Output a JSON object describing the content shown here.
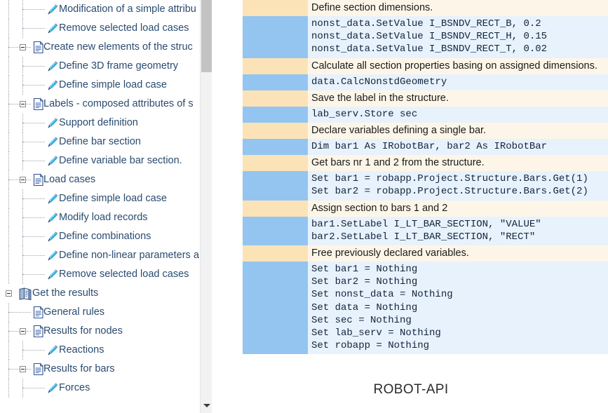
{
  "tree": {
    "items": [
      {
        "label": "Modification of a simple attribu",
        "level": 2,
        "icon": "pencil-icon",
        "expander": false,
        "truncated": true
      },
      {
        "label": "Remove selected load cases",
        "level": 2,
        "icon": "pencil-icon",
        "expander": false,
        "truncated": false,
        "last": true
      },
      {
        "label": "Create new elements of the struc",
        "level": 1,
        "icon": "page-icon",
        "expander": "minus",
        "truncated": true
      },
      {
        "label": "Define 3D frame geometry",
        "level": 2,
        "icon": "pencil-icon",
        "expander": false,
        "truncated": false
      },
      {
        "label": "Define simple load case",
        "level": 2,
        "icon": "pencil-icon",
        "expander": false,
        "truncated": false,
        "last": true
      },
      {
        "label": "Labels - composed attributes of s",
        "level": 1,
        "icon": "page-icon",
        "expander": "minus",
        "truncated": true
      },
      {
        "label": "Support definition",
        "level": 2,
        "icon": "pencil-icon",
        "expander": false,
        "truncated": false
      },
      {
        "label": "Define bar section",
        "level": 2,
        "icon": "pencil-icon",
        "expander": false,
        "truncated": false
      },
      {
        "label": "Define variable bar section.",
        "level": 2,
        "icon": "pencil-icon",
        "expander": false,
        "truncated": false,
        "last": true
      },
      {
        "label": "Load cases",
        "level": 1,
        "icon": "page-icon",
        "expander": "minus",
        "truncated": false
      },
      {
        "label": "Define simple load case",
        "level": 2,
        "icon": "pencil-icon",
        "expander": false,
        "truncated": false
      },
      {
        "label": "Modify load records",
        "level": 2,
        "icon": "pencil-icon",
        "expander": false,
        "truncated": false
      },
      {
        "label": "Define combinations",
        "level": 2,
        "icon": "pencil-icon",
        "expander": false,
        "truncated": false
      },
      {
        "label": "Define non-linear parameters a",
        "level": 2,
        "icon": "pencil-icon",
        "expander": false,
        "truncated": true
      },
      {
        "label": "Remove selected load cases",
        "level": 2,
        "icon": "pencil-icon",
        "expander": false,
        "truncated": false,
        "last": true
      },
      {
        "label": "Get the results",
        "level": 0,
        "icon": "book-icon",
        "expander": "minus",
        "truncated": false
      },
      {
        "label": "General rules",
        "level": 1,
        "icon": "page-icon",
        "expander": false,
        "truncated": false
      },
      {
        "label": "Results for nodes",
        "level": 1,
        "icon": "page-icon",
        "expander": "minus",
        "truncated": false
      },
      {
        "label": "Reactions",
        "level": 2,
        "icon": "pencil-icon",
        "expander": false,
        "truncated": false,
        "last": true
      },
      {
        "label": "Results for bars",
        "level": 1,
        "icon": "page-icon",
        "expander": "minus",
        "truncated": false
      },
      {
        "label": "Forces",
        "level": 2,
        "icon": "pencil-icon",
        "expander": false,
        "truncated": false,
        "last": true
      }
    ],
    "scrollbar": {
      "down_arrow_icon": "chevron-down-icon"
    }
  },
  "code": {
    "rows": [
      {
        "type": "comment",
        "lines": [
          "Define section dimensions."
        ]
      },
      {
        "type": "code",
        "lines": [
          "nonst_data.SetValue I_BSNDV_RECT_B, 0.2",
          "nonst_data.SetValue I_BSNDV_RECT_H, 0.15",
          "nonst_data.SetValue I_BSNDV_RECT_T, 0.02"
        ]
      },
      {
        "type": "comment",
        "lines": [
          "Calculate all section properties basing on assigned dimensions."
        ]
      },
      {
        "type": "code",
        "lines": [
          "data.CalcNonstdGeometry"
        ]
      },
      {
        "type": "comment",
        "lines": [
          "Save the label in the structure."
        ]
      },
      {
        "type": "code",
        "lines": [
          "lab_serv.Store sec"
        ]
      },
      {
        "type": "comment",
        "lines": [
          "Declare variables defining a single bar."
        ]
      },
      {
        "type": "code",
        "lines": [
          "Dim bar1 As IRobotBar, bar2 As IRobotBar"
        ]
      },
      {
        "type": "comment",
        "lines": [
          "Get bars nr 1 and 2 from the structure."
        ]
      },
      {
        "type": "code",
        "lines": [
          "Set bar1 = robapp.Project.Structure.Bars.Get(1)",
          "Set bar2 = robapp.Project.Structure.Bars.Get(2)"
        ]
      },
      {
        "type": "comment",
        "lines": [
          "Assign section to bars 1 and 2"
        ]
      },
      {
        "type": "code",
        "lines": [
          "bar1.SetLabel I_LT_BAR_SECTION, \"VALUE\"",
          "bar2.SetLabel I_LT_BAR_SECTION, \"RECT\""
        ]
      },
      {
        "type": "comment",
        "lines": [
          "Free previously declared variables."
        ]
      },
      {
        "type": "code",
        "lines": [
          "Set bar1 = Nothing",
          "Set bar2 = Nothing",
          "Set nonst_data = Nothing",
          "Set data = Nothing",
          "Set sec = Nothing",
          "Set lab_serv = Nothing",
          "Set robapp = Nothing"
        ]
      }
    ],
    "footer_brand": "ROBOT-API"
  },
  "colors": {
    "comment_gutter": "#fce3b7",
    "comment_bg": "#fdf6e8",
    "code_gutter": "#93c5f0",
    "code_bg": "#e8f2fc",
    "tree_text": "#2a4b70",
    "scrollbar_thumb": "#c3c3c3"
  }
}
